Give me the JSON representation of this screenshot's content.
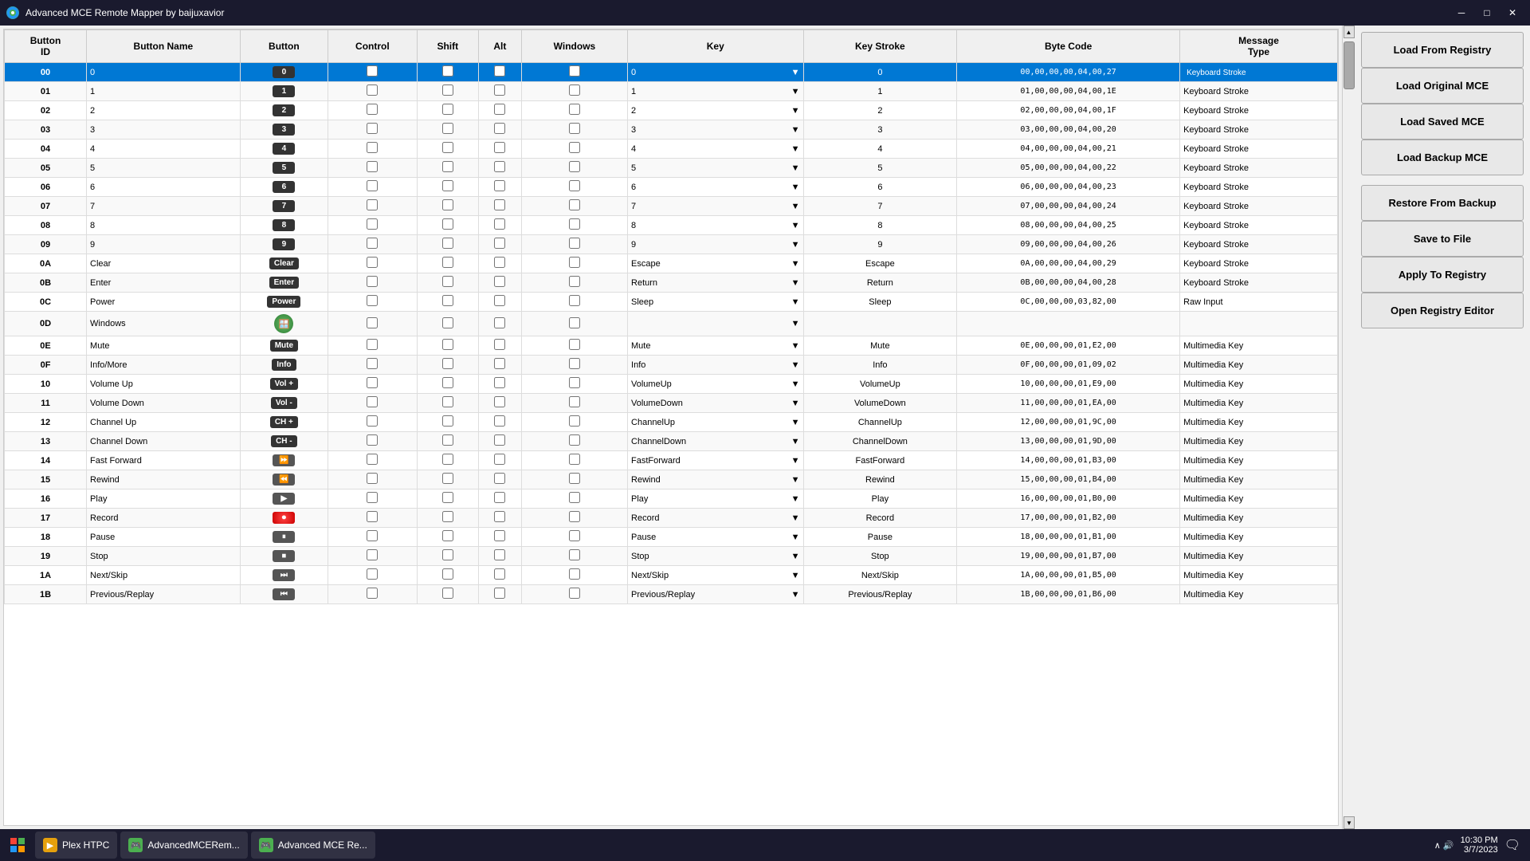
{
  "app": {
    "title": "Advanced MCE Remote Mapper by baijuxavior",
    "icon": "🎮"
  },
  "titlebar": {
    "minimize": "─",
    "maximize": "□",
    "close": "✕"
  },
  "table": {
    "headers": [
      "Button ID",
      "Button Name",
      "Button",
      "Control",
      "Shift",
      "Alt",
      "Windows",
      "Key",
      "Key Stroke",
      "Byte Code",
      "Message Type"
    ],
    "rows": [
      {
        "id": "00",
        "name": "0",
        "button": "0",
        "control": false,
        "shift": false,
        "alt": false,
        "windows": false,
        "key": "0",
        "keystroke": "0",
        "bytecode": "00,00,00,00,04,00,27",
        "msgtype": "Keyboard Stroke",
        "selected": true
      },
      {
        "id": "01",
        "name": "1",
        "button": "1",
        "control": false,
        "shift": false,
        "alt": false,
        "windows": false,
        "key": "1",
        "keystroke": "1",
        "bytecode": "01,00,00,00,04,00,1E",
        "msgtype": "Keyboard Stroke",
        "selected": false
      },
      {
        "id": "02",
        "name": "2",
        "button": "2",
        "control": false,
        "shift": false,
        "alt": false,
        "windows": false,
        "key": "2",
        "keystroke": "2",
        "bytecode": "02,00,00,00,04,00,1F",
        "msgtype": "Keyboard Stroke",
        "selected": false
      },
      {
        "id": "03",
        "name": "3",
        "button": "3",
        "control": false,
        "shift": false,
        "alt": false,
        "windows": false,
        "key": "3",
        "keystroke": "3",
        "bytecode": "03,00,00,00,04,00,20",
        "msgtype": "Keyboard Stroke",
        "selected": false
      },
      {
        "id": "04",
        "name": "4",
        "button": "4",
        "control": false,
        "shift": false,
        "alt": false,
        "windows": false,
        "key": "4",
        "keystroke": "4",
        "bytecode": "04,00,00,00,04,00,21",
        "msgtype": "Keyboard Stroke",
        "selected": false
      },
      {
        "id": "05",
        "name": "5",
        "button": "5",
        "control": false,
        "shift": false,
        "alt": false,
        "windows": false,
        "key": "5",
        "keystroke": "5",
        "bytecode": "05,00,00,00,04,00,22",
        "msgtype": "Keyboard Stroke",
        "selected": false
      },
      {
        "id": "06",
        "name": "6",
        "button": "6",
        "control": false,
        "shift": false,
        "alt": false,
        "windows": false,
        "key": "6",
        "keystroke": "6",
        "bytecode": "06,00,00,00,04,00,23",
        "msgtype": "Keyboard Stroke",
        "selected": false
      },
      {
        "id": "07",
        "name": "7",
        "button": "7",
        "control": false,
        "shift": false,
        "alt": false,
        "windows": false,
        "key": "7",
        "keystroke": "7",
        "bytecode": "07,00,00,00,04,00,24",
        "msgtype": "Keyboard Stroke",
        "selected": false
      },
      {
        "id": "08",
        "name": "8",
        "button": "8",
        "control": false,
        "shift": false,
        "alt": false,
        "windows": false,
        "key": "8",
        "keystroke": "8",
        "bytecode": "08,00,00,00,04,00,25",
        "msgtype": "Keyboard Stroke",
        "selected": false
      },
      {
        "id": "09",
        "name": "9",
        "button": "9",
        "control": false,
        "shift": false,
        "alt": false,
        "windows": false,
        "key": "9",
        "keystroke": "9",
        "bytecode": "09,00,00,00,04,00,26",
        "msgtype": "Keyboard Stroke",
        "selected": false
      },
      {
        "id": "0A",
        "name": "Clear",
        "button": "Clear",
        "control": false,
        "shift": false,
        "alt": false,
        "windows": false,
        "key": "Escape",
        "keystroke": "Escape",
        "bytecode": "0A,00,00,00,04,00,29",
        "msgtype": "Keyboard Stroke",
        "selected": false
      },
      {
        "id": "0B",
        "name": "Enter",
        "button": "Enter",
        "control": false,
        "shift": false,
        "alt": false,
        "windows": false,
        "key": "Return",
        "keystroke": "Return",
        "bytecode": "0B,00,00,00,04,00,28",
        "msgtype": "Keyboard Stroke",
        "selected": false
      },
      {
        "id": "0C",
        "name": "Power",
        "button": "Power",
        "control": false,
        "shift": false,
        "alt": false,
        "windows": false,
        "key": "Sleep",
        "keystroke": "Sleep",
        "bytecode": "0C,00,00,00,03,82,00",
        "msgtype": "Raw Input",
        "selected": false
      },
      {
        "id": "0D",
        "name": "Windows",
        "button": "WIN",
        "control": false,
        "shift": false,
        "alt": false,
        "windows": false,
        "key": "",
        "keystroke": "",
        "bytecode": "",
        "msgtype": "",
        "selected": false
      },
      {
        "id": "0E",
        "name": "Mute",
        "button": "Mute",
        "control": false,
        "shift": false,
        "alt": false,
        "windows": false,
        "key": "Mute",
        "keystroke": "Mute",
        "bytecode": "0E,00,00,00,01,E2,00",
        "msgtype": "Multimedia Key",
        "selected": false
      },
      {
        "id": "0F",
        "name": "Info/More",
        "button": "Info",
        "control": false,
        "shift": false,
        "alt": false,
        "windows": false,
        "key": "Info",
        "keystroke": "Info",
        "bytecode": "0F,00,00,00,01,09,02",
        "msgtype": "Multimedia Key",
        "selected": false
      },
      {
        "id": "10",
        "name": "Volume Up",
        "button": "Vol +",
        "control": false,
        "shift": false,
        "alt": false,
        "windows": false,
        "key": "VolumeUp",
        "keystroke": "VolumeUp",
        "bytecode": "10,00,00,00,01,E9,00",
        "msgtype": "Multimedia Key",
        "selected": false
      },
      {
        "id": "11",
        "name": "Volume Down",
        "button": "Vol -",
        "control": false,
        "shift": false,
        "alt": false,
        "windows": false,
        "key": "VolumeDown",
        "keystroke": "VolumeDown",
        "bytecode": "11,00,00,00,01,EA,00",
        "msgtype": "Multimedia Key",
        "selected": false
      },
      {
        "id": "12",
        "name": "Channel Up",
        "button": "CH +",
        "control": false,
        "shift": false,
        "alt": false,
        "windows": false,
        "key": "ChannelUp",
        "keystroke": "ChannelUp",
        "bytecode": "12,00,00,00,01,9C,00",
        "msgtype": "Multimedia Key",
        "selected": false
      },
      {
        "id": "13",
        "name": "Channel Down",
        "button": "CH -",
        "control": false,
        "shift": false,
        "alt": false,
        "windows": false,
        "key": "ChannelDown",
        "keystroke": "ChannelDown",
        "bytecode": "13,00,00,00,01,9D,00",
        "msgtype": "Multimedia Key",
        "selected": false
      },
      {
        "id": "14",
        "name": "Fast Forward",
        "button": "FF",
        "control": false,
        "shift": false,
        "alt": false,
        "windows": false,
        "key": "FastForward",
        "keystroke": "FastForward",
        "bytecode": "14,00,00,00,01,B3,00",
        "msgtype": "Multimedia Key",
        "selected": false
      },
      {
        "id": "15",
        "name": "Rewind",
        "button": "REW",
        "control": false,
        "shift": false,
        "alt": false,
        "windows": false,
        "key": "Rewind",
        "keystroke": "Rewind",
        "bytecode": "15,00,00,00,01,B4,00",
        "msgtype": "Multimedia Key",
        "selected": false
      },
      {
        "id": "16",
        "name": "Play",
        "button": "PLAY",
        "control": false,
        "shift": false,
        "alt": false,
        "windows": false,
        "key": "Play",
        "keystroke": "Play",
        "bytecode": "16,00,00,00,01,B0,00",
        "msgtype": "Multimedia Key",
        "selected": false
      },
      {
        "id": "17",
        "name": "Record",
        "button": "REC",
        "control": false,
        "shift": false,
        "alt": false,
        "windows": false,
        "key": "Record",
        "keystroke": "Record",
        "bytecode": "17,00,00,00,01,B2,00",
        "msgtype": "Multimedia Key",
        "selected": false
      },
      {
        "id": "18",
        "name": "Pause",
        "button": "PAUSE",
        "control": false,
        "shift": false,
        "alt": false,
        "windows": false,
        "key": "Pause",
        "keystroke": "Pause",
        "bytecode": "18,00,00,00,01,B1,00",
        "msgtype": "Multimedia Key",
        "selected": false
      },
      {
        "id": "19",
        "name": "Stop",
        "button": "STOP",
        "control": false,
        "shift": false,
        "alt": false,
        "windows": false,
        "key": "Stop",
        "keystroke": "Stop",
        "bytecode": "19,00,00,00,01,B7,00",
        "msgtype": "Multimedia Key",
        "selected": false
      },
      {
        "id": "1A",
        "name": "Next/Skip",
        "button": "NEXT",
        "control": false,
        "shift": false,
        "alt": false,
        "windows": false,
        "key": "Next/Skip",
        "keystroke": "Next/Skip",
        "bytecode": "1A,00,00,00,01,B5,00",
        "msgtype": "Multimedia Key",
        "selected": false
      },
      {
        "id": "1B",
        "name": "Previous/Replay",
        "button": "PREV",
        "control": false,
        "shift": false,
        "alt": false,
        "windows": false,
        "key": "Previous/Replay",
        "keystroke": "Previous/Replay",
        "bytecode": "1B,00,00,00,01,B6,00",
        "msgtype": "Multimedia Key",
        "selected": false
      }
    ]
  },
  "sidebar": {
    "buttons": [
      {
        "id": "load-from-registry",
        "label": "Load From Registry"
      },
      {
        "id": "load-original-mce",
        "label": "Load Original MCE"
      },
      {
        "id": "load-saved-mce",
        "label": "Load Saved MCE"
      },
      {
        "id": "load-backup-mce",
        "label": "Load Backup MCE"
      },
      {
        "id": "restore-from-backup",
        "label": "Restore From Backup"
      },
      {
        "id": "save-to-file",
        "label": "Save to File"
      },
      {
        "id": "apply-to-registry",
        "label": "Apply To Registry"
      },
      {
        "id": "open-registry-editor",
        "label": "Open Registry Editor"
      }
    ]
  },
  "taskbar": {
    "start_icon": "⊞",
    "items": [
      {
        "id": "plex",
        "label": "Plex HTPC",
        "color": "#e5a00d"
      },
      {
        "id": "advmce1",
        "label": "AdvancedMCERem...",
        "color": "#4CAF50"
      },
      {
        "id": "advmce2",
        "label": "Advanced MCE Re...",
        "color": "#4CAF50"
      }
    ],
    "tray": {
      "time": "10:30 PM",
      "date": "3/7/2023"
    }
  }
}
